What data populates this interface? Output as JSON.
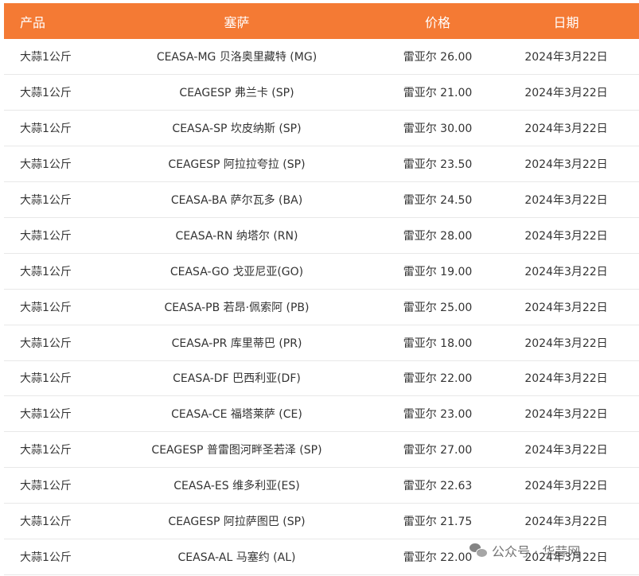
{
  "table": {
    "headers": [
      "产品",
      "塞萨",
      "价格",
      "日期"
    ],
    "rows": [
      [
        "大蒜1公斤",
        "CEASA-MG 贝洛奥里藏特 (MG)",
        "雷亚尔 26.00",
        "2024年3月22日"
      ],
      [
        "大蒜1公斤",
        "CEAGESP 弗兰卡 (SP)",
        "雷亚尔 21.00",
        "2024年3月22日"
      ],
      [
        "大蒜1公斤",
        "CEASA-SP 坎皮纳斯 (SP)",
        "雷亚尔 30.00",
        "2024年3月22日"
      ],
      [
        "大蒜1公斤",
        "CEAGESP 阿拉拉夸拉 (SP)",
        "雷亚尔 23.50",
        "2024年3月22日"
      ],
      [
        "大蒜1公斤",
        "CEASA-BA 萨尔瓦多 (BA)",
        "雷亚尔 24.50",
        "2024年3月22日"
      ],
      [
        "大蒜1公斤",
        "CEASA-RN 纳塔尔 (RN)",
        "雷亚尔 28.00",
        "2024年3月22日"
      ],
      [
        "大蒜1公斤",
        "CEASA-GO 戈亚尼亚(GO)",
        "雷亚尔 19.00",
        "2024年3月22日"
      ],
      [
        "大蒜1公斤",
        "CEASA-PB 若昂·佩索阿 (PB)",
        "雷亚尔 25.00",
        "2024年3月22日"
      ],
      [
        "大蒜1公斤",
        "CEASA-PR 库里蒂巴 (PR)",
        "雷亚尔 18.00",
        "2024年3月22日"
      ],
      [
        "大蒜1公斤",
        "CEASA-DF 巴西利亚(DF)",
        "雷亚尔 22.00",
        "2024年3月22日"
      ],
      [
        "大蒜1公斤",
        "CEASA-CE 福塔莱萨 (CE)",
        "雷亚尔 23.00",
        "2024年3月22日"
      ],
      [
        "大蒜1公斤",
        "CEAGESP 普雷图河畔圣若泽 (SP)",
        "雷亚尔 27.00",
        "2024年3月22日"
      ],
      [
        "大蒜1公斤",
        "CEASA-ES 维多利亚(ES)",
        "雷亚尔 22.63",
        "2024年3月22日"
      ],
      [
        "大蒜1公斤",
        "CEAGESP 阿拉萨图巴 (SP)",
        "雷亚尔 21.75",
        "2024年3月22日"
      ],
      [
        "大蒜1公斤",
        "CEASA-AL 马塞约 (AL)",
        "雷亚尔 22.00",
        "2024年3月22日"
      ]
    ]
  },
  "watermark": {
    "text": "公众号 · 华蒜网",
    "icon": "wechat-icon"
  },
  "colors": {
    "header_bg": "#f47a34",
    "header_text": "#ffffff",
    "row_divider": "#e8e8e8",
    "cell_text": "#333333"
  }
}
